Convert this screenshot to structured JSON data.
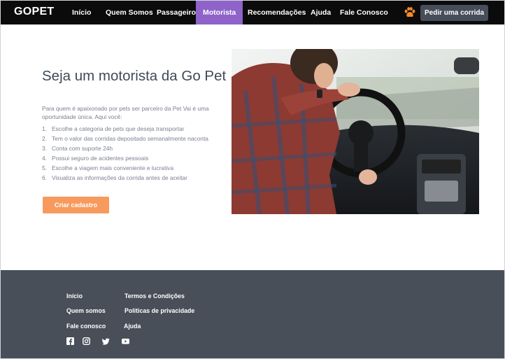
{
  "nav": {
    "brand": "GOPET",
    "items": [
      {
        "label": "Início"
      },
      {
        "label": "Quem Somos"
      },
      {
        "label": "Passageiro"
      },
      {
        "label": "Motorista"
      },
      {
        "label": "Recomendações"
      },
      {
        "label": "Ajuda"
      },
      {
        "label": "Fale Conosco"
      }
    ],
    "cta_label": "Pedir uma corrida",
    "paw_icon": "paw-icon",
    "accent_color": "#8f63c9"
  },
  "hero": {
    "title": "Seja um motorista da Go Pet",
    "intro": "Para quem é apaixonado por pets ser parceiro da Pet Vai é uma oportunidade única. Aqui você:",
    "benefits": [
      {
        "num": "1.",
        "text": "Escolhe a categoria de pets que deseja transportar"
      },
      {
        "num": "2.",
        "text": "Tem o valor das corridas depositado semanalmente naconta"
      },
      {
        "num": "3.",
        "text": "Conta com suporte 24h"
      },
      {
        "num": "4.",
        "text": "Possui seguro de acidentes pessoais"
      },
      {
        "num": "5.",
        "text": "Escolhe a viagem mais conveniente e lucrativa"
      },
      {
        "num": "6.",
        "text": "Visualiza as informações da corrida antes de aceitar"
      }
    ],
    "cta_label": "Criar cadastro",
    "cta_color": "#f79a5e"
  },
  "footer": {
    "links": [
      {
        "label": "Início"
      },
      {
        "label": "Termos e Condições"
      },
      {
        "label": "Quem somos"
      },
      {
        "label": "Políticas de privacidade"
      },
      {
        "label": "Fale conosco"
      },
      {
        "label": "Ajuda"
      }
    ],
    "social_icons": [
      "facebook-icon",
      "instagram-icon",
      "twitter-icon",
      "youtube-icon"
    ],
    "background": "#484f59"
  }
}
